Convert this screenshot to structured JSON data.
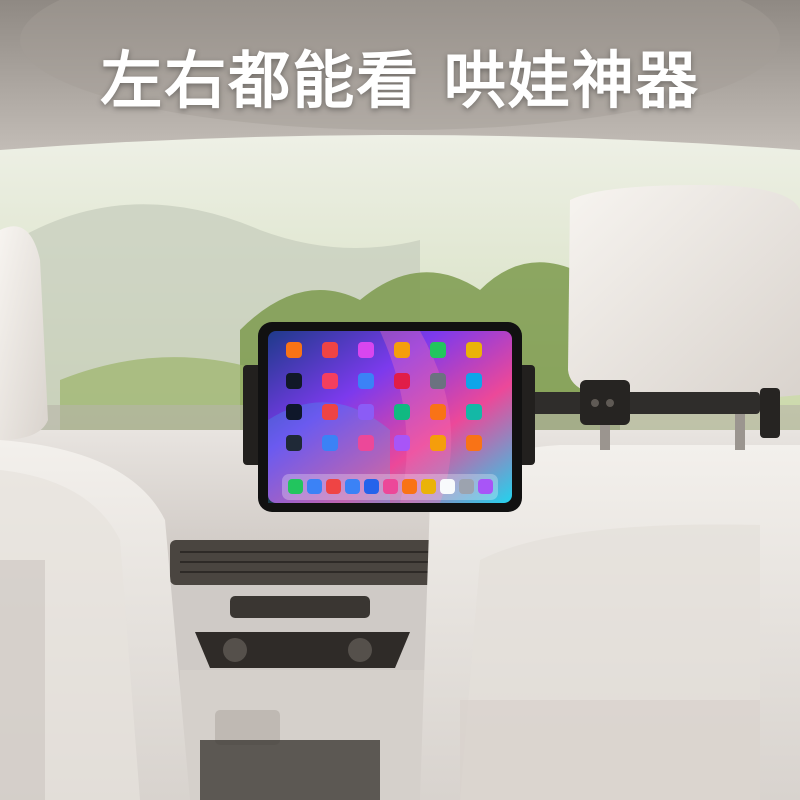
{
  "headline": "左右都能看 哄娃神器",
  "tablet": {
    "wallpaper_colors": [
      "#1e3a8a",
      "#7c3aed",
      "#ec4899",
      "#22d3ee"
    ],
    "app_icon_colors": [
      "#f97316",
      "#ef4444",
      "#d946ef",
      "#f59e0b",
      "#22c55e",
      "#eab308",
      "#111827",
      "#f43f5e",
      "#3b82f6",
      "#e11d48",
      "#6b7280",
      "#0ea5e9",
      "#0f172a",
      "#ef4444",
      "#8b5cf6",
      "#10b981",
      "#f97316",
      "#14b8a6",
      "#1f2937",
      "#3b82f6",
      "#ec4899",
      "#a855f7",
      "#f59e0b",
      "#f97316"
    ],
    "dock_icon_colors": [
      "#22c55e",
      "#3b82f6",
      "#ef4444",
      "#3b82f6",
      "#2563eb",
      "#ec4899",
      "#f97316",
      "#eab308",
      "#f8fafc",
      "#9ca3af",
      "#a855f7"
    ]
  }
}
